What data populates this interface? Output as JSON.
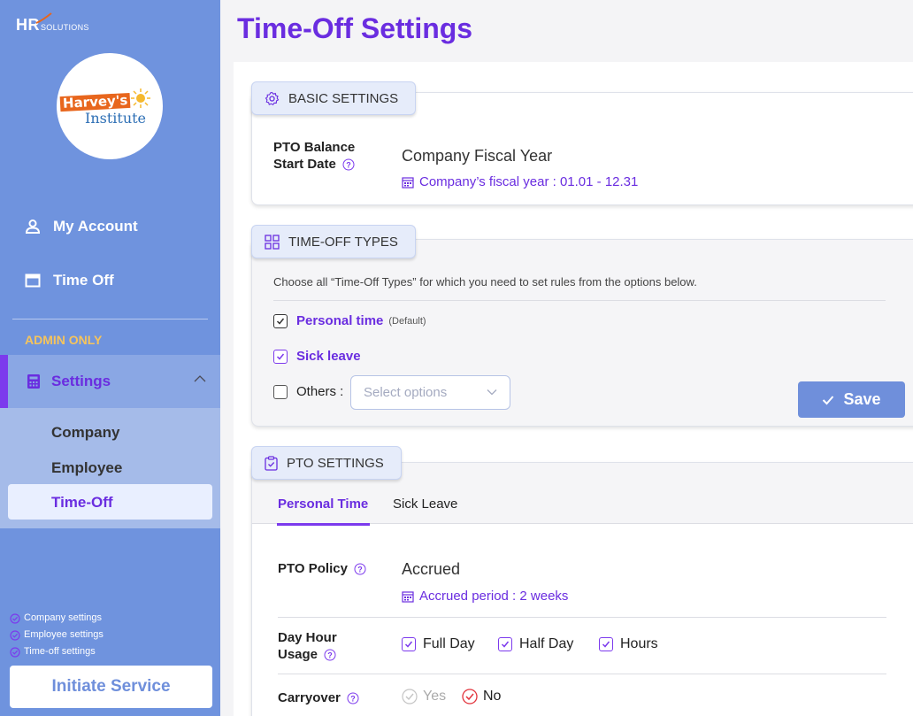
{
  "sidebar": {
    "logo": {
      "main": "HR",
      "sub": "SOLUTIONS"
    },
    "company_logo": {
      "line1": "Harvey's",
      "line2": "Institute"
    },
    "nav": [
      {
        "label": "My Account",
        "icon": "user-icon"
      },
      {
        "label": "Time Off",
        "icon": "calendar-icon"
      }
    ],
    "admin_label": "ADMIN ONLY",
    "settings": {
      "label": "Settings",
      "icon": "calculator-icon",
      "expanded": true,
      "children": [
        "Company",
        "Employee",
        "Time-Off"
      ],
      "active_child": "Time-Off"
    },
    "checklist": [
      "Company settings",
      "Employee settings",
      "Time-off settings"
    ],
    "initiate_label": "Initiate Service"
  },
  "page": {
    "title": "Time-Off Settings"
  },
  "basic": {
    "tab_label": "BASIC SETTINGS",
    "icon": "gear-icon",
    "pto_label_line1": "PTO Balance",
    "pto_label_line2": "Start Date",
    "value": "Company Fiscal Year",
    "link": "Company’s fiscal year : 01.01 - 12.31"
  },
  "types": {
    "tab_label": "TIME-OFF TYPES",
    "icon": "grid-icon",
    "intro": "Choose all “Time-Off Types” for which you need to set rules from the options below.",
    "options": [
      {
        "label": "Personal time",
        "tag": "(Default)",
        "checked": true
      },
      {
        "label": "Sick leave",
        "checked": true
      },
      {
        "label": "Others :",
        "checked": false
      }
    ],
    "select_placeholder": "Select options",
    "save_label": "Save"
  },
  "pto": {
    "tab_label": "PTO SETTINGS",
    "icon": "clipboard-icon",
    "tabs": [
      "Personal Time",
      "Sick Leave"
    ],
    "active_tab": "Personal Time",
    "policy_label": "PTO Policy",
    "policy_value": "Accrued",
    "policy_link": "Accrued period : 2 weeks",
    "usage_label_line1": "Day Hour",
    "usage_label_line2": "Usage",
    "usage_options": [
      "Full Day",
      "Half Day",
      "Hours"
    ],
    "carryover_label": "Carryover",
    "carryover_options": {
      "yes": "Yes",
      "no": "No"
    },
    "carryover_selected": "No"
  },
  "colors": {
    "accent": "#6a2de0",
    "sidebar": "#6f93de",
    "save": "#6f8fdb",
    "admin": "#f6c45c"
  }
}
